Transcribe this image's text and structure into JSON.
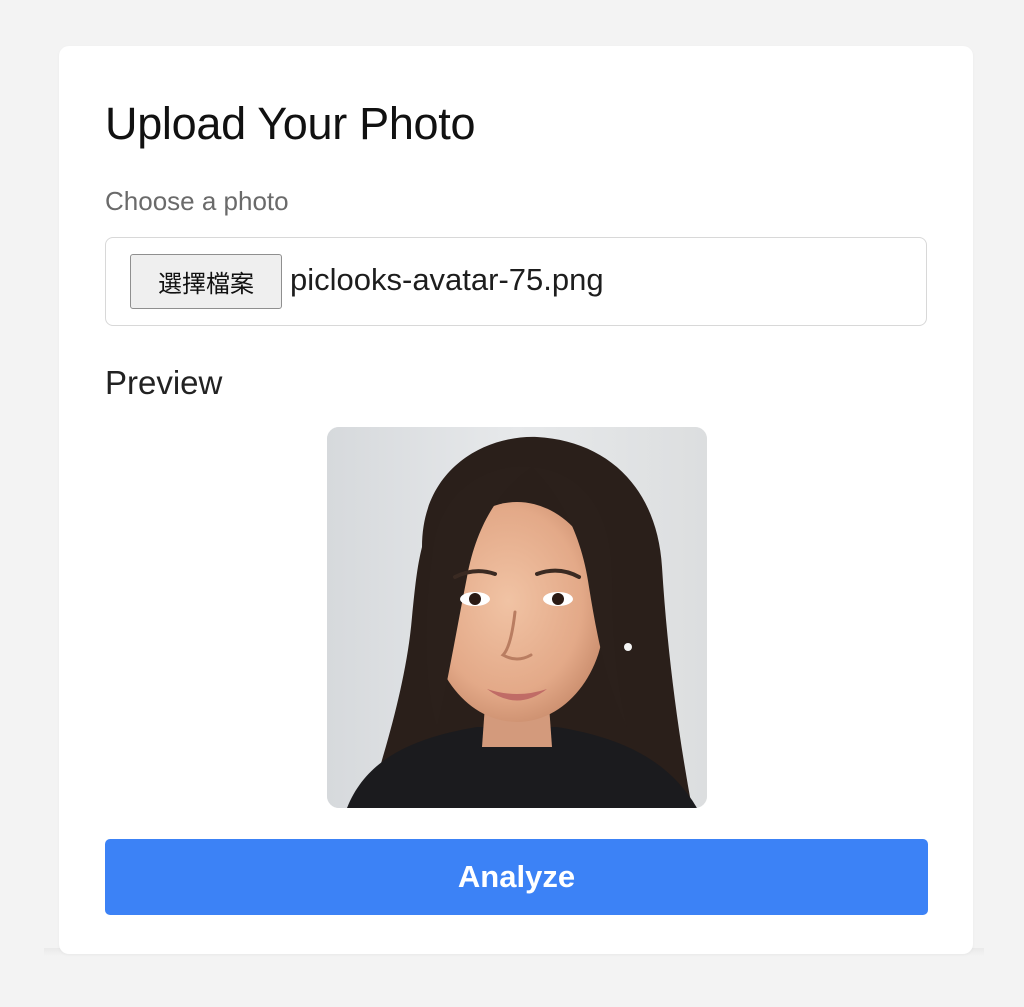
{
  "upload": {
    "title": "Upload Your Photo",
    "choose_label": "Choose a photo",
    "file_button_label": "選擇檔案",
    "file_name": "piclooks-avatar-75.png",
    "preview_label": "Preview",
    "analyze_label": "Analyze"
  },
  "colors": {
    "accent": "#3c82f6",
    "page_background": "#f3f3f3",
    "card_background": "#ffffff"
  }
}
